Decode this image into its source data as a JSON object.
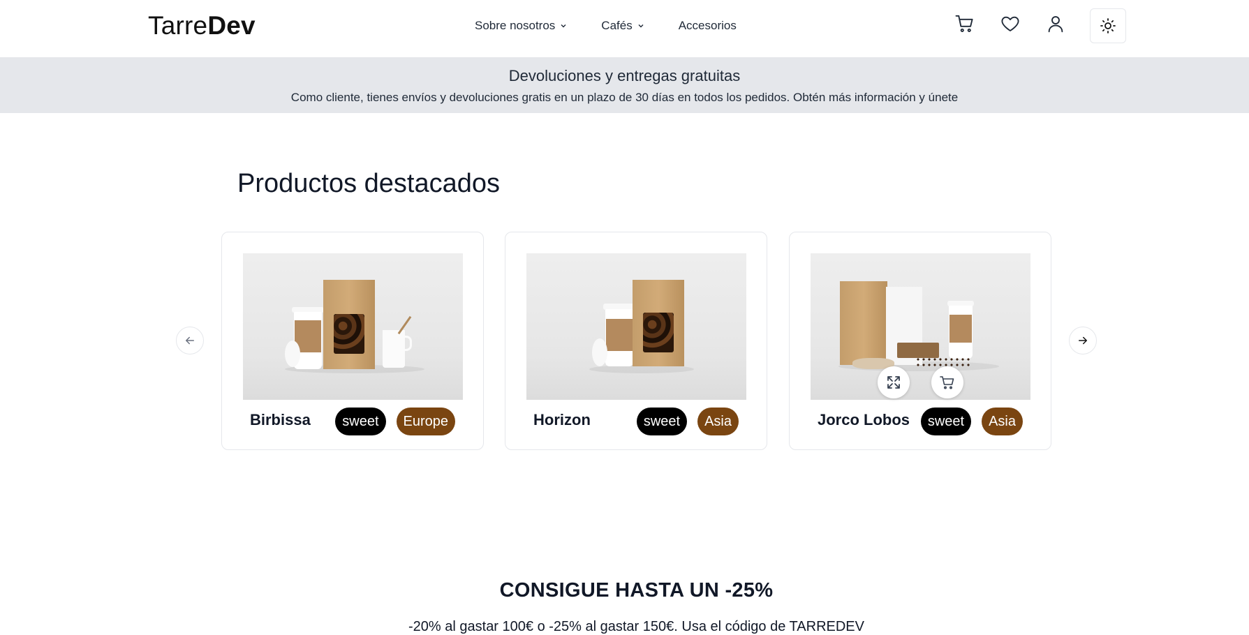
{
  "header": {
    "logo_light": "Tarre",
    "logo_bold": "Dev",
    "nav": [
      {
        "label": "Sobre nosotros",
        "has_dropdown": true,
        "icon": "chevron-down-icon"
      },
      {
        "label": "Cafés",
        "has_dropdown": true,
        "icon": "chevron-down-icon"
      },
      {
        "label": "Accesorios",
        "has_dropdown": false
      }
    ],
    "icons": [
      "cart-icon",
      "heart-icon",
      "user-icon",
      "sun-icon"
    ]
  },
  "banner": {
    "title": "Devoluciones y entregas gratuitas",
    "text": "Como cliente, tienes envíos y devoluciones gratis en un plazo de 30 días en todos los pedidos. Obtén más información y únete",
    "background": "#e5e7eb"
  },
  "featured": {
    "title": "Productos destacados",
    "prev_icon": "arrow-left-icon",
    "next_icon": "arrow-right-icon",
    "products": [
      {
        "name": "Birbissa",
        "flavor": "sweet",
        "origin": "Europe"
      },
      {
        "name": "Horizon",
        "flavor": "sweet",
        "origin": "Asia"
      },
      {
        "name": "Jorco Lobos",
        "flavor": "sweet",
        "origin": "Asia",
        "hover_actions": [
          "expand-icon",
          "cart-icon"
        ]
      }
    ]
  },
  "promo": {
    "title": "CONSIGUE HASTA UN -25%",
    "text": "-20% al gastar 100€ o -25% al gastar 150€. Usa el código de TARREDEV"
  },
  "colors": {
    "flavor_tag": "#000000",
    "origin_tag": "#7a4511",
    "text": "#111827"
  }
}
